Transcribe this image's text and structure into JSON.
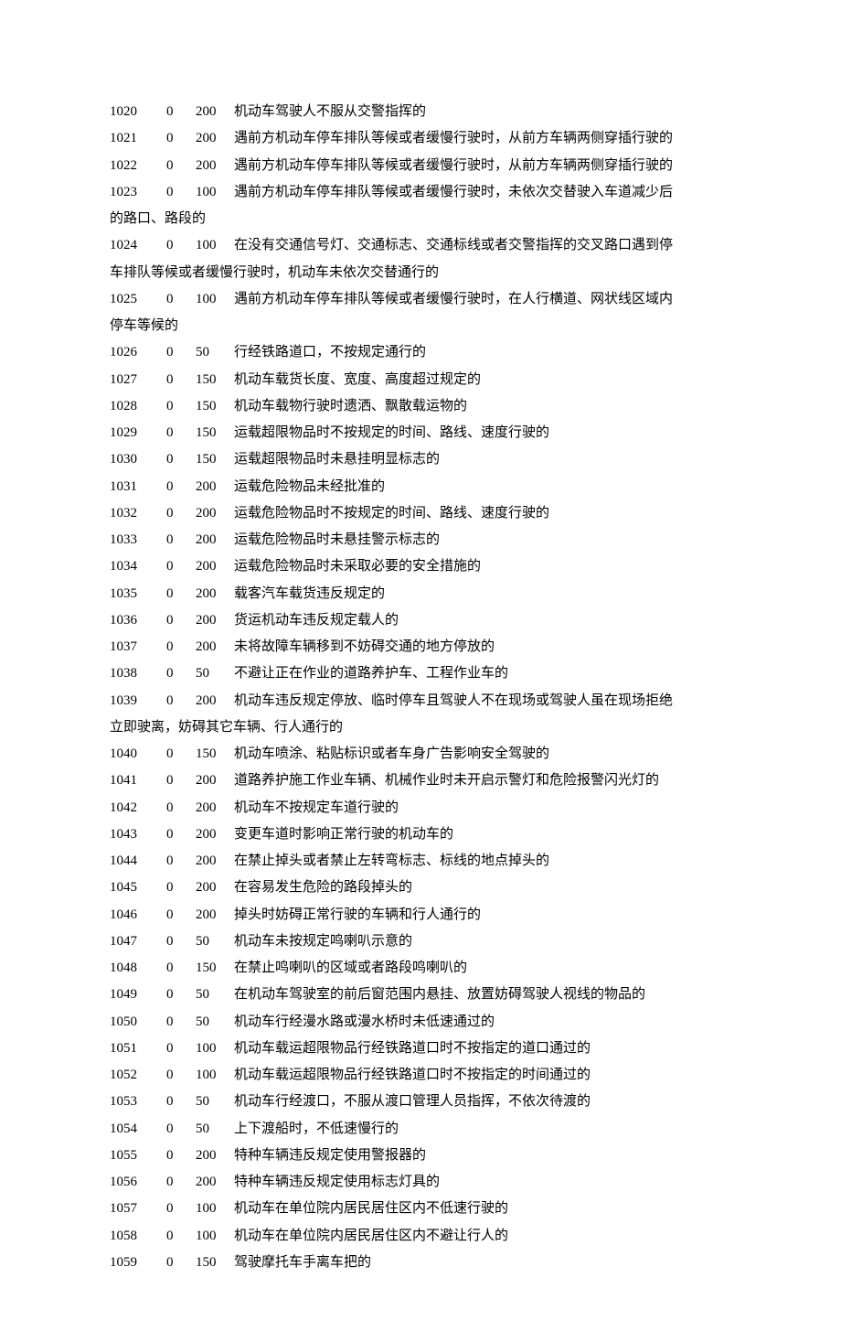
{
  "rows": [
    {
      "code": "1020",
      "c2": "0",
      "c3": "200",
      "desc": "机动车驾驶人不服从交警指挥的"
    },
    {
      "code": "1021",
      "c2": "0",
      "c3": "200",
      "desc": "遇前方机动车停车排队等候或者缓慢行驶时，从前方车辆两侧穿插行驶的"
    },
    {
      "code": "1022",
      "c2": "0",
      "c3": "200",
      "desc": "遇前方机动车停车排队等候或者缓慢行驶时，从前方车辆两侧穿插行驶的"
    },
    {
      "code": "1023",
      "c2": "0",
      "c3": "100",
      "desc": "遇前方机动车停车排队等候或者缓慢行驶时，未依次交替驶入车道减少后",
      "cont": "的路口、路段的"
    },
    {
      "code": "1024",
      "c2": "0",
      "c3": "100",
      "desc": "在没有交通信号灯、交通标志、交通标线或者交警指挥的交叉路口遇到停",
      "cont": "车排队等候或者缓慢行驶时，机动车未依次交替通行的"
    },
    {
      "code": "1025",
      "c2": "0",
      "c3": "100",
      "desc": "遇前方机动车停车排队等候或者缓慢行驶时，在人行横道、网状线区域内",
      "cont": "停车等候的"
    },
    {
      "code": "1026",
      "c2": "0",
      "c3": "50",
      "desc": "行经铁路道口，不按规定通行的"
    },
    {
      "code": "1027",
      "c2": "0",
      "c3": "150",
      "desc": "机动车载货长度、宽度、高度超过规定的"
    },
    {
      "code": "1028",
      "c2": "0",
      "c3": "150",
      "desc": "机动车载物行驶时遗洒、飘散载运物的"
    },
    {
      "code": "1029",
      "c2": "0",
      "c3": "150",
      "desc": "运载超限物品时不按规定的时间、路线、速度行驶的"
    },
    {
      "code": "1030",
      "c2": "0",
      "c3": "150",
      "desc": "运载超限物品时未悬挂明显标志的"
    },
    {
      "code": "1031",
      "c2": "0",
      "c3": "200",
      "desc": "运载危险物品未经批准的"
    },
    {
      "code": "1032",
      "c2": "0",
      "c3": "200",
      "desc": "运载危险物品时不按规定的时间、路线、速度行驶的"
    },
    {
      "code": "1033",
      "c2": "0",
      "c3": "200",
      "desc": "运载危险物品时未悬挂警示标志的"
    },
    {
      "code": "1034",
      "c2": "0",
      "c3": "200",
      "desc": "运载危险物品时未采取必要的安全措施的"
    },
    {
      "code": "1035",
      "c2": "0",
      "c3": "200",
      "desc": "载客汽车载货违反规定的"
    },
    {
      "code": "1036",
      "c2": "0",
      "c3": "200",
      "desc": "货运机动车违反规定载人的"
    },
    {
      "code": "1037",
      "c2": "0",
      "c3": "200",
      "desc": "未将故障车辆移到不妨碍交通的地方停放的"
    },
    {
      "code": "1038",
      "c2": "0",
      "c3": "50",
      "desc": "不避让正在作业的道路养护车、工程作业车的"
    },
    {
      "code": "1039",
      "c2": "0",
      "c3": "200",
      "desc": "机动车违反规定停放、临时停车且驾驶人不在现场或驾驶人虽在现场拒绝",
      "cont": "立即驶离，妨碍其它车辆、行人通行的"
    },
    {
      "code": "1040",
      "c2": "0",
      "c3": "150",
      "desc": "机动车喷涂、粘贴标识或者车身广告影响安全驾驶的"
    },
    {
      "code": "1041",
      "c2": "0",
      "c3": "200",
      "desc": "道路养护施工作业车辆、机械作业时未开启示警灯和危险报警闪光灯的"
    },
    {
      "code": "1042",
      "c2": "0",
      "c3": "200",
      "desc": "机动车不按规定车道行驶的"
    },
    {
      "code": "1043",
      "c2": "0",
      "c3": "200",
      "desc": "变更车道时影响正常行驶的机动车的"
    },
    {
      "code": "1044",
      "c2": "0",
      "c3": "200",
      "desc": "在禁止掉头或者禁止左转弯标志、标线的地点掉头的"
    },
    {
      "code": "1045",
      "c2": "0",
      "c3": "200",
      "desc": "在容易发生危险的路段掉头的"
    },
    {
      "code": "1046",
      "c2": "0",
      "c3": "200",
      "desc": "掉头时妨碍正常行驶的车辆和行人通行的"
    },
    {
      "code": "1047",
      "c2": "0",
      "c3": "50",
      "desc": "机动车未按规定鸣喇叭示意的"
    },
    {
      "code": "1048",
      "c2": "0",
      "c3": "150",
      "desc": "在禁止鸣喇叭的区域或者路段鸣喇叭的"
    },
    {
      "code": "1049",
      "c2": "0",
      "c3": "50",
      "desc": "在机动车驾驶室的前后窗范围内悬挂、放置妨碍驾驶人视线的物品的"
    },
    {
      "code": "1050",
      "c2": "0",
      "c3": "50",
      "desc": "机动车行经漫水路或漫水桥时未低速通过的"
    },
    {
      "code": "1051",
      "c2": "0",
      "c3": "100",
      "desc": "机动车载运超限物品行经铁路道口时不按指定的道口通过的"
    },
    {
      "code": "1052",
      "c2": "0",
      "c3": "100",
      "desc": "机动车载运超限物品行经铁路道口时不按指定的时间通过的"
    },
    {
      "code": "1053",
      "c2": "0",
      "c3": "50",
      "desc": "机动车行经渡口，不服从渡口管理人员指挥，不依次待渡的"
    },
    {
      "code": "1054",
      "c2": "0",
      "c3": "50",
      "desc": "上下渡船时，不低速慢行的"
    },
    {
      "code": "1055",
      "c2": "0",
      "c3": "200",
      "desc": "特种车辆违反规定使用警报器的"
    },
    {
      "code": "1056",
      "c2": "0",
      "c3": "200",
      "desc": "特种车辆违反规定使用标志灯具的"
    },
    {
      "code": "1057",
      "c2": "0",
      "c3": "100",
      "desc": "机动车在单位院内居民居住区内不低速行驶的"
    },
    {
      "code": "1058",
      "c2": "0",
      "c3": "100",
      "desc": "机动车在单位院内居民居住区内不避让行人的"
    },
    {
      "code": "1059",
      "c2": "0",
      "c3": "150",
      "desc": "驾驶摩托车手离车把的"
    }
  ]
}
